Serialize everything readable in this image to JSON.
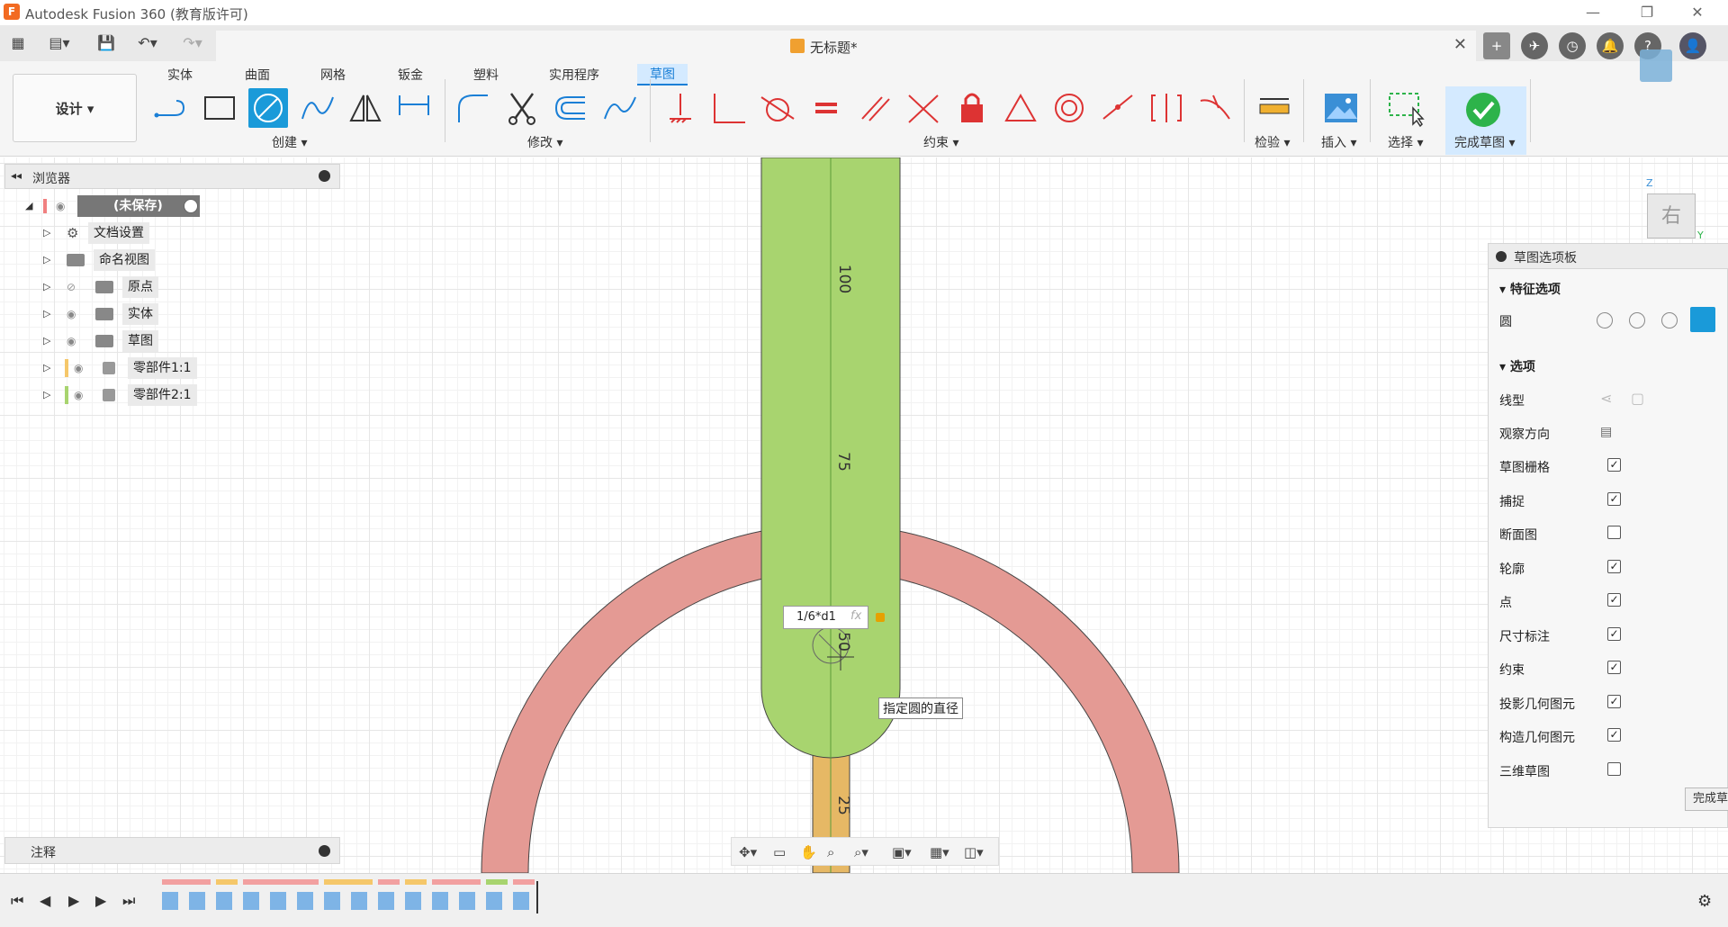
{
  "window": {
    "app_title": "Autodesk Fusion 360 (教育版许可)",
    "app_icon_letter": "F",
    "minimize": "—",
    "restore": "❐",
    "close": "✕"
  },
  "document": {
    "title": "无标题*",
    "close": "✕"
  },
  "ribbon": {
    "design_button": "设计 ▾",
    "tabs": [
      "实体",
      "曲面",
      "网格",
      "钣金",
      "塑料",
      "实用程序",
      "草图"
    ],
    "active_tab": "草图",
    "groups": {
      "create": "创建 ▾",
      "modify": "修改 ▾",
      "constraints": "约束 ▾",
      "inspect": "检验 ▾",
      "insert": "插入 ▾",
      "select": "选择 ▾",
      "finish": "完成草图 ▾"
    }
  },
  "browser": {
    "header": "浏览器",
    "root": "(未保存)",
    "items": [
      "文档设置",
      "命名视图",
      "原点",
      "实体",
      "草图",
      "零部件1:1",
      "零部件2:1"
    ]
  },
  "notes": {
    "header": "注释"
  },
  "canvas": {
    "dim_100": "100",
    "dim_75": "75",
    "dim_50": "50",
    "dim_25": "25",
    "input_value": "1/6*d1",
    "fx": "fx",
    "tooltip": "指定圆的直径",
    "viewcube_label": "右",
    "axis_z": "Z",
    "axis_y": "Y"
  },
  "palette": {
    "title": "草图选项板",
    "feature_section": "特征选项",
    "circle_label": "圆",
    "options_section": "选项",
    "linetype": "线型",
    "look_at": "观察方向",
    "finish_button": "完成草",
    "options": [
      {
        "label": "草图栅格",
        "checked": true
      },
      {
        "label": "捕捉",
        "checked": true
      },
      {
        "label": "断面图",
        "checked": false
      },
      {
        "label": "轮廓",
        "checked": true
      },
      {
        "label": "点",
        "checked": true
      },
      {
        "label": "尺寸标注",
        "checked": true
      },
      {
        "label": "约束",
        "checked": true
      },
      {
        "label": "投影几何图元",
        "checked": true
      },
      {
        "label": "构造几何图元",
        "checked": true
      },
      {
        "label": "三维草图",
        "checked": false
      }
    ]
  },
  "colors": {
    "accent": "#1a9ad9",
    "green_profile": "#a8d46f",
    "red_profile": "#e49a94",
    "orange_profile": "#e6b865",
    "finish_green": "#2db34a"
  }
}
